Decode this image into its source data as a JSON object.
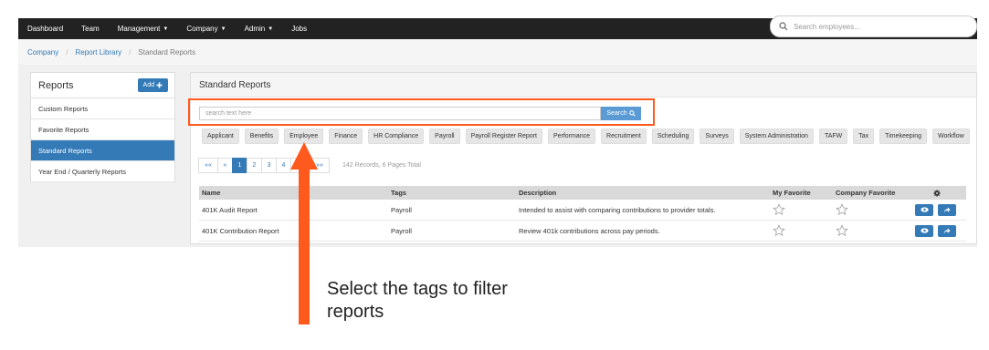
{
  "nav": {
    "items": [
      {
        "label": "Dashboard",
        "caret": false
      },
      {
        "label": "Team",
        "caret": false
      },
      {
        "label": "Management",
        "caret": true
      },
      {
        "label": "Company",
        "caret": true
      },
      {
        "label": "Admin",
        "caret": true
      },
      {
        "label": "Jobs",
        "caret": false
      }
    ],
    "search_placeholder": "Search employees..."
  },
  "breadcrumb": {
    "items": [
      "Company",
      "Report Library"
    ],
    "current": "Standard Reports",
    "separator": "/"
  },
  "sidebar": {
    "title": "Reports",
    "add_label": "Add",
    "items": [
      {
        "label": "Custom Reports",
        "active": false
      },
      {
        "label": "Favorite Reports",
        "active": false
      },
      {
        "label": "Standard Reports",
        "active": true
      },
      {
        "label": "Year End / Quarterly Reports",
        "active": false
      }
    ]
  },
  "main": {
    "title": "Standard Reports",
    "search_placeholder": "search text here",
    "search_button": "Search",
    "tags": [
      "Applicant",
      "Benefits",
      "Employee",
      "Finance",
      "HR Compliance",
      "Payroll",
      "Payroll Register Report",
      "Performance",
      "Recruitment",
      "Scheduling",
      "Surveys",
      "System Administration",
      "TAFW",
      "Tax",
      "Timekeeping",
      "Workflow"
    ],
    "pager": {
      "first": "«« ",
      "prev": "«",
      "pages": [
        "1",
        "2",
        "3",
        "4"
      ],
      "next": "»",
      "last": "»»",
      "current": "1"
    },
    "records_text": "142 Records, 6 Pages Total",
    "columns": {
      "name": "Name",
      "tags": "Tags",
      "description": "Description",
      "my_favorite": "My Favorite",
      "company_favorite": "Company Favorite"
    },
    "rows": [
      {
        "name": "401K Audit Report",
        "tags": "Payroll",
        "description": "Intended to assist with comparing contributions to provider totals."
      },
      {
        "name": "401K Contribution Report",
        "tags": "Payroll",
        "description": "Review 401k contributions across pay periods."
      }
    ]
  },
  "annotation": {
    "text": "Select the tags to filter reports",
    "color": "#ff5a1e"
  }
}
